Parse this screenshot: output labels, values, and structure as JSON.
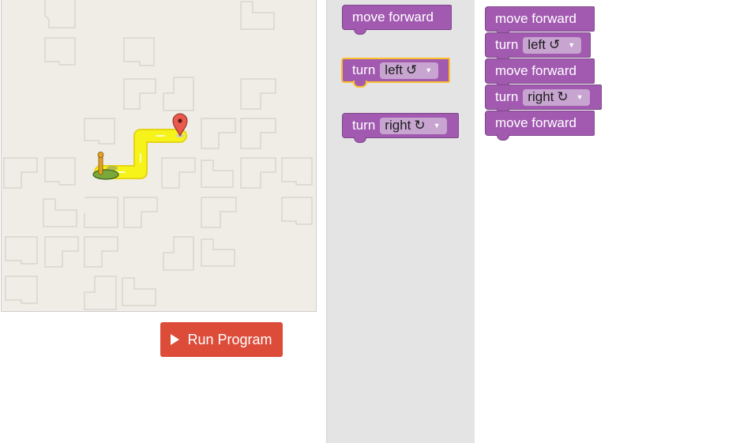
{
  "toolbox": {
    "blocks": [
      {
        "type": "move",
        "label": "move forward"
      },
      {
        "type": "turn",
        "label": "turn",
        "direction": "left",
        "symbol": "↺",
        "selected": true
      },
      {
        "type": "turn",
        "label": "turn",
        "direction": "right",
        "symbol": "↻"
      }
    ]
  },
  "workspace": {
    "blocks": [
      {
        "type": "move",
        "label": "move forward"
      },
      {
        "type": "turn",
        "label": "turn",
        "direction": "left",
        "symbol": "↺"
      },
      {
        "type": "move",
        "label": "move forward"
      },
      {
        "type": "turn",
        "label": "turn",
        "direction": "right",
        "symbol": "↻"
      },
      {
        "type": "move",
        "label": "move forward"
      }
    ]
  },
  "run_button": {
    "label": "Run Program"
  },
  "colors": {
    "block": "#a25ab1",
    "block_border": "#7e4689",
    "dropdown": "#c7a5d0",
    "selected_outline": "#fbc02d",
    "run_button": "#dd4b39",
    "path": "#f5f31a",
    "maze_bg": "#efede6",
    "marker": "#e05a4f"
  },
  "icons": {
    "start": "pegman-start-icon",
    "goal": "map-marker-icon",
    "run": "play-icon"
  }
}
